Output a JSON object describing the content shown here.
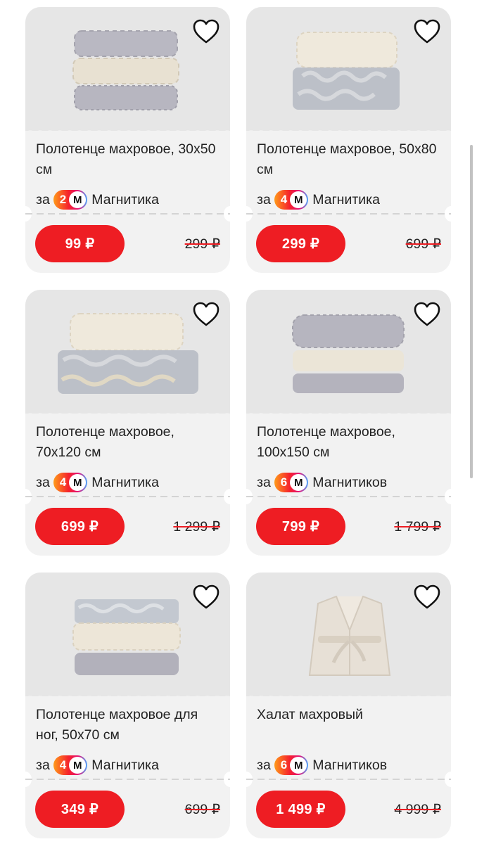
{
  "products": [
    {
      "title": "Полотенце махровое, 30х50 см",
      "loyalty_prefix": "за",
      "points": "2",
      "points_icon": "М",
      "points_unit": "Магнитика",
      "price": "99 ₽",
      "old_price": "299 ₽",
      "image": "towel-stack-grey-cream"
    },
    {
      "title": "Полотенце махровое, 50х80 см",
      "loyalty_prefix": "за",
      "points": "4",
      "points_icon": "М",
      "points_unit": "Магнитика",
      "price": "299 ₽",
      "old_price": "699 ₽",
      "image": "towel-stack-cream-floral"
    },
    {
      "title": "Полотенце махровое, 70х120 см",
      "loyalty_prefix": "за",
      "points": "4",
      "points_icon": "М",
      "points_unit": "Магнитика",
      "price": "699 ₽",
      "old_price": "1 299 ₽",
      "image": "towel-stack-cream-floral"
    },
    {
      "title": "Полотенце махровое, 100х150 см",
      "loyalty_prefix": "за",
      "points": "6",
      "points_icon": "М",
      "points_unit": "Магнитиков",
      "price": "799 ₽",
      "old_price": "1 799 ₽",
      "image": "towel-stack-grey-cream"
    },
    {
      "title": "Полотенце махровое для ног, 50х70 см",
      "loyalty_prefix": "за",
      "points": "4",
      "points_icon": "М",
      "points_unit": "Магнитика",
      "price": "349 ₽",
      "old_price": "699 ₽",
      "image": "towel-stack-floral-cream-grey"
    },
    {
      "title": "Халат махровый",
      "loyalty_prefix": "за",
      "points": "6",
      "points_icon": "М",
      "points_unit": "Магнитиков",
      "price": "1 499 ₽",
      "old_price": "4 999 ₽",
      "image": "bathrobe"
    }
  ],
  "colors": {
    "accent": "#ee1d23",
    "card_bg": "#f2f2f2",
    "image_bg": "#e6e6e6"
  }
}
